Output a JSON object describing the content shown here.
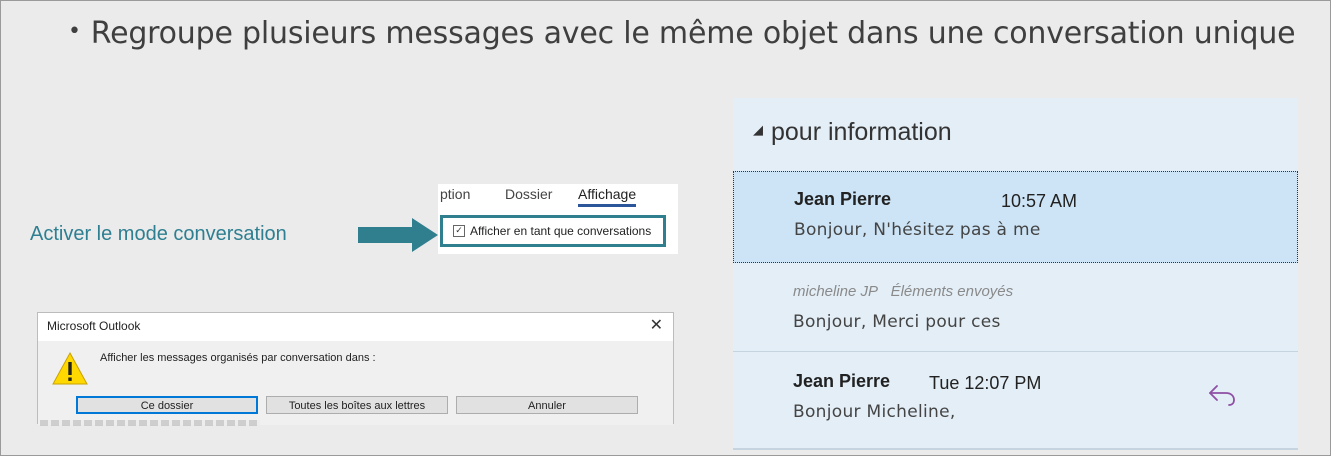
{
  "slide": {
    "bullet_text": "Regroupe plusieurs messages avec le même objet dans une conversation unique",
    "annotation": "Activer le mode conversation"
  },
  "ribbon": {
    "tabs": [
      "ption",
      "Dossier",
      "Affichage"
    ],
    "active_tab": "Affichage",
    "conversation_checkbox_label": "Afficher en tant que conversations",
    "conversation_checked": true
  },
  "dialog": {
    "title": "Microsoft Outlook",
    "close": "✕",
    "message": "Afficher les messages organisés par conversation dans :",
    "buttons": [
      "Ce dossier",
      "Toutes les boîtes aux lettres",
      "Annuler"
    ]
  },
  "message_list": {
    "group_header": "pour information",
    "messages": [
      {
        "sender": "Jean Pierre",
        "time": "10:57 AM",
        "preview": "Bonjour,  N'hésitez pas à me",
        "selected": true
      },
      {
        "sender_italic": "micheline JP",
        "folder": "Éléments envoyés",
        "preview": "Bonjour,  Merci pour ces"
      },
      {
        "sender": "Jean Pierre",
        "time": "Tue 12:07 PM",
        "preview": "Bonjour Micheline,",
        "replied": true
      }
    ]
  },
  "colors": {
    "accent_teal": "#2f7f8f",
    "list_background": "#e3eef7",
    "selected_row": "#cde4f6",
    "reply_icon": "#8e4fa5"
  }
}
